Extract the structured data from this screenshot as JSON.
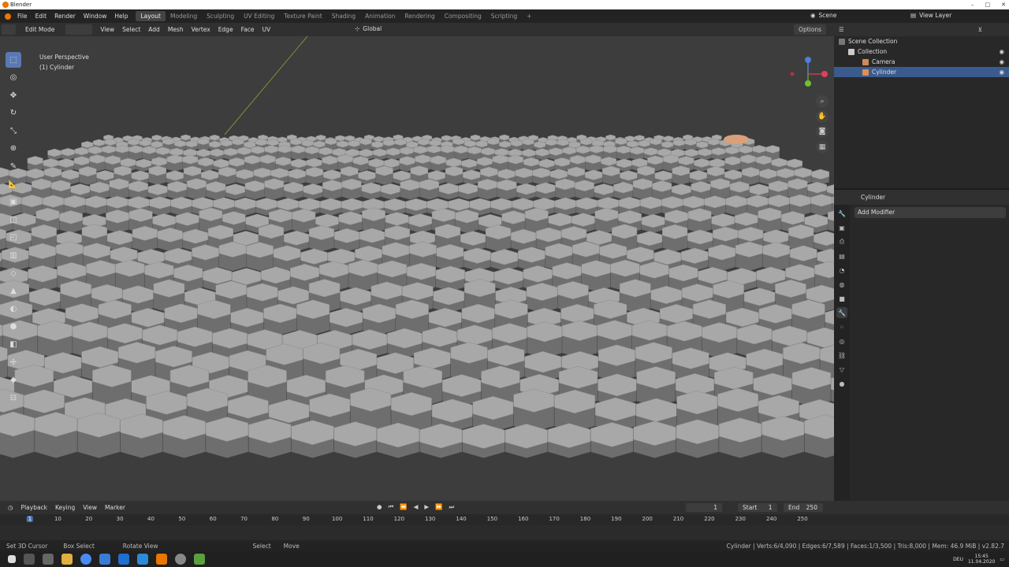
{
  "window": {
    "title": "Blender"
  },
  "menu": {
    "file": "File",
    "edit": "Edit",
    "render": "Render",
    "window": "Window",
    "help": "Help"
  },
  "workspaces": [
    "Layout",
    "Modeling",
    "Sculpting",
    "UV Editing",
    "Texture Paint",
    "Shading",
    "Animation",
    "Rendering",
    "Compositing",
    "Scripting",
    "+"
  ],
  "scene": {
    "label": "Scene",
    "view_layer": "View Layer"
  },
  "header": {
    "mode": "Edit Mode",
    "view": "View",
    "select": "Select",
    "add": "Add",
    "mesh": "Mesh",
    "vertex": "Vertex",
    "edge": "Edge",
    "face": "Face",
    "uv": "UV",
    "orientation": "Global",
    "options": "Options"
  },
  "viewport": {
    "perspective": "User Perspective",
    "object": "(1) Cylinder"
  },
  "gizmo": {
    "x": "X",
    "y": "Y",
    "z": "Z"
  },
  "outliner": {
    "root": "Scene Collection",
    "collection": "Collection",
    "camera": "Camera",
    "cylinder": "Cylinder"
  },
  "properties": {
    "object": "Cylinder",
    "add_modifier": "Add Modifier"
  },
  "timeline": {
    "playback": "Playback",
    "keying": "Keying",
    "view": "View",
    "marker": "Marker",
    "current": "1",
    "start_label": "Start",
    "start": "1",
    "end_label": "End",
    "end": "250",
    "ticks": [
      "1",
      "10",
      "20",
      "30",
      "40",
      "50",
      "60",
      "70",
      "80",
      "90",
      "100",
      "110",
      "120",
      "130",
      "140",
      "150",
      "160",
      "170",
      "180",
      "190",
      "200",
      "210",
      "220",
      "230",
      "240",
      "250"
    ]
  },
  "status": {
    "cursor": "Set 3D Cursor",
    "box": "Box Select",
    "rotate": "Rotate View",
    "select": "Select",
    "move": "Move",
    "stats": "Cylinder | Verts:6/4,090 | Edges:6/7,589 | Faces:1/3,500 | Tris:8,000 | Mem: 46.9 MiB | v2.82.7"
  },
  "taskbar": {
    "time": "15:45",
    "date": "11.04.2020",
    "lang": "DEU"
  },
  "colors": {
    "accent": "#4772b3",
    "brand": "#ea7600",
    "viewport": "#3d3d3d",
    "hex": "#a8a8a8"
  }
}
